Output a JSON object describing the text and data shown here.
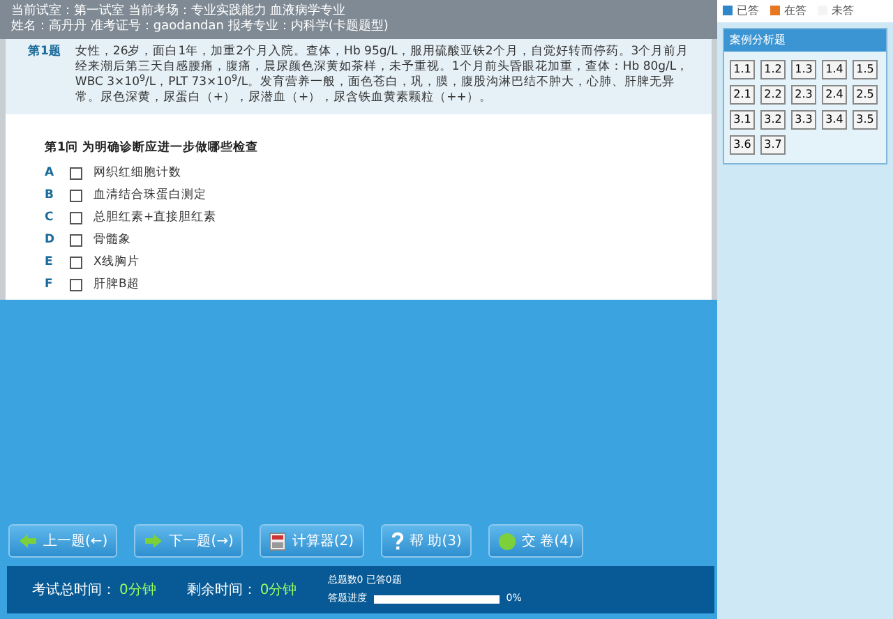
{
  "header": {
    "line1": "当前试室：第一试室  当前考场：专业实践能力 血液病学专业",
    "line2": "姓名：高丹丹  准考证号：gaodandan  报考专业：内科学(卡题题型)"
  },
  "question": {
    "number": "第1题",
    "stem": "女性，26岁，面白1年，加重2个月入院。查体，Hb 95g/L，服用硫酸亚铁2个月，自觉好转而停药。3个月前月经来潮后第三天自感腰痛，腹痛，晨尿颜色深黄如茶样，未予重视。1个月前头昏眼花加重，查体：Hb 80g/L，WBC 3×10$^{9}$/L，PLT 73×10$^{9}$/L。发育营养一般，面色苍白，巩，膜，腹股沟淋巴结不肿大，心肺、肝脾无异常。尿色深黄，尿蛋白（+），尿潜血（+），尿含铁血黄素颗粒（++）。",
    "sub": "第1问 为明确诊断应进一步做哪些检查",
    "options": [
      {
        "letter": "A",
        "text": "网织红细胞计数",
        "checked": false
      },
      {
        "letter": "B",
        "text": "血清结合珠蛋白测定",
        "checked": false
      },
      {
        "letter": "C",
        "text": "总胆红素+直接胆红素",
        "checked": false
      },
      {
        "letter": "D",
        "text": "骨髓象",
        "checked": false
      },
      {
        "letter": "E",
        "text": "X线胸片",
        "checked": false
      },
      {
        "letter": "F",
        "text": "肝脾B超",
        "checked": false
      }
    ]
  },
  "legend": [
    {
      "label": "已答",
      "color": "#2f86c8"
    },
    {
      "label": "在答",
      "color": "#e87722"
    },
    {
      "label": "未答",
      "color": "#f4f4f4"
    }
  ],
  "panel": {
    "title": "案例分析题",
    "items": [
      {
        "label": "1.1",
        "selected": false
      },
      {
        "label": "1.2",
        "selected": false
      },
      {
        "label": "1.3",
        "selected": false
      },
      {
        "label": "1.4",
        "selected": false
      },
      {
        "label": "1.5",
        "selected": false
      },
      {
        "label": "2.1",
        "selected": false
      },
      {
        "label": "2.2",
        "selected": false
      },
      {
        "label": "2.3",
        "selected": false
      },
      {
        "label": "2.4",
        "selected": false
      },
      {
        "label": "2.5",
        "selected": false
      },
      {
        "label": "3.1",
        "selected": false
      },
      {
        "label": "3.2",
        "selected": false
      },
      {
        "label": "3.3",
        "selected": false
      },
      {
        "label": "3.4",
        "selected": false
      },
      {
        "label": "3.5",
        "selected": false
      },
      {
        "label": "3.6",
        "selected": false
      },
      {
        "label": "3.7",
        "selected": false
      }
    ]
  },
  "buttons": [
    {
      "label": "上一题(←)",
      "kind": "prev"
    },
    {
      "label": "下一题(→)",
      "kind": "next"
    },
    {
      "label": "计算器(2)",
      "kind": "calc"
    },
    {
      "label": "帮 助(3)",
      "kind": "help"
    },
    {
      "label": "交 卷(4)",
      "kind": "submit"
    }
  ],
  "status": {
    "total_label": "考试总时间：",
    "total": "0分钟",
    "remain_label": "剩余时间：",
    "remain": "0分钟",
    "count": "总题数0  已答0题",
    "progress_label": "答题进度",
    "level": 0,
    "percent": "0%"
  }
}
